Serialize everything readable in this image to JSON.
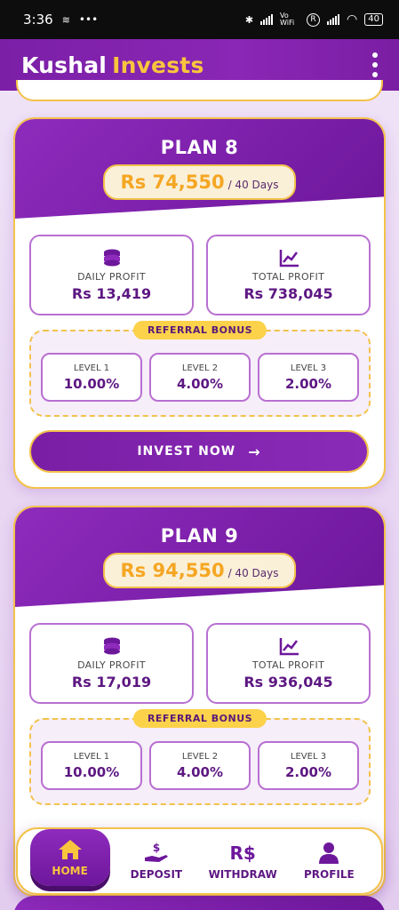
{
  "status_bar": {
    "time": "3:36",
    "battery": "40",
    "network_label": "Vo WiFi",
    "sim_badge": "R"
  },
  "header": {
    "brand_primary": "Kushal",
    "brand_accent": "Invests",
    "menu_icon": "kebab-menu-icon"
  },
  "plans": [
    {
      "title": "PLAN 8",
      "price": "Rs 74,550",
      "duration": "/ 40 Days",
      "daily_profit_label": "DAILY PROFIT",
      "daily_profit_value": "Rs 13,419",
      "total_profit_label": "TOTAL PROFIT",
      "total_profit_value": "Rs 738,045",
      "referral_label": "REFERRAL BONUS",
      "levels": [
        {
          "label": "LEVEL 1",
          "value": "10.00%"
        },
        {
          "label": "LEVEL 2",
          "value": "4.00%"
        },
        {
          "label": "LEVEL 3",
          "value": "2.00%"
        }
      ],
      "invest_label": "INVEST NOW"
    },
    {
      "title": "PLAN 9",
      "price": "Rs 94,550",
      "duration": "/ 40 Days",
      "daily_profit_label": "DAILY PROFIT",
      "daily_profit_value": "Rs 17,019",
      "total_profit_label": "TOTAL PROFIT",
      "total_profit_value": "Rs 936,045",
      "referral_label": "REFERRAL BONUS",
      "levels": [
        {
          "label": "LEVEL 1",
          "value": "10.00%"
        },
        {
          "label": "LEVEL 2",
          "value": "4.00%"
        },
        {
          "label": "LEVEL 3",
          "value": "2.00%"
        }
      ]
    }
  ],
  "nav": {
    "items": [
      {
        "label": "HOME",
        "icon": "home-icon",
        "active": true
      },
      {
        "label": "DEPOSIT",
        "icon": "deposit-hand-icon",
        "active": false
      },
      {
        "label": "WITHDRAW",
        "icon": "rupee-icon",
        "active": false
      },
      {
        "label": "PROFILE",
        "icon": "profile-icon",
        "active": false
      }
    ],
    "withdraw_glyph": "R$"
  },
  "colors": {
    "brand_purple": "#7b1fa6",
    "accent_gold": "#f9c53d",
    "border_gold": "#f3c24a",
    "value_purple": "#5d1782"
  }
}
